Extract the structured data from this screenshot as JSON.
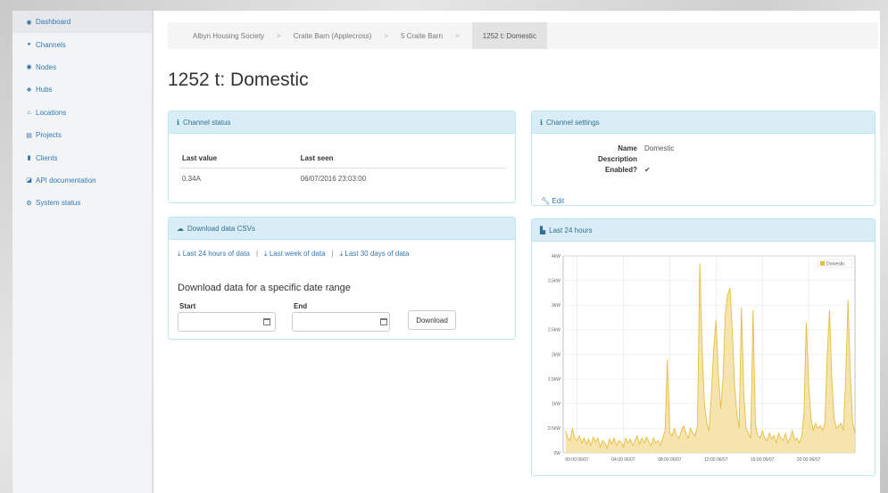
{
  "sidebar": {
    "items": [
      {
        "label": "Dashboard",
        "icon": "dashboard-icon",
        "glyph": "◉"
      },
      {
        "label": "Channels",
        "icon": "channels-icon",
        "glyph": "⚭"
      },
      {
        "label": "Nodes",
        "icon": "nodes-icon",
        "glyph": "◉"
      },
      {
        "label": "Hubs",
        "icon": "hubs-icon",
        "glyph": "❖"
      },
      {
        "label": "Locations",
        "icon": "home-icon",
        "glyph": "⌂"
      },
      {
        "label": "Projects",
        "icon": "projects-icon",
        "glyph": "▤"
      },
      {
        "label": "Clients",
        "icon": "clients-icon",
        "glyph": "▮"
      },
      {
        "label": "API documentation",
        "icon": "book-icon",
        "glyph": "◪"
      },
      {
        "label": "System status",
        "icon": "cogs-icon",
        "glyph": "⚙"
      }
    ]
  },
  "breadcrumb": {
    "items": [
      "Albyn Housing Society",
      "Craite Barn (Applecross)",
      "5 Craite Barn"
    ],
    "separator": ">",
    "active": "1252 t: Domestic"
  },
  "page": {
    "title": "1252 t: Domestic"
  },
  "channel_status": {
    "heading": "Channel status",
    "headers": [
      "Last value",
      "Last seen"
    ],
    "row": [
      "0.34A",
      "06/07/2016 23:03:00"
    ]
  },
  "channel_settings": {
    "heading": "Channel settings",
    "name_label": "Name",
    "name_value": "Domestic",
    "description_label": "Description",
    "description_value": "",
    "enabled_label": "Enabled?",
    "enabled_value": "✔",
    "edit_label": "Edit"
  },
  "download": {
    "heading": "Download data CSVs",
    "links": [
      "Last 24 hours of data",
      "Last week of data",
      "Last 30 days of data"
    ],
    "link_separator": "|",
    "range_title": "Download data for a specific date range",
    "start_label": "Start",
    "end_label": "End",
    "start_value": "",
    "end_value": "",
    "button_label": "Download"
  },
  "chart_panel": {
    "heading": "Last 24 hours"
  },
  "colors": {
    "accent": "#337ab7",
    "panel_head": "#d9edf7",
    "series_line": "#e6bd3f",
    "series_fill": "#f5dfa0"
  },
  "chart_data": {
    "type": "area",
    "title": "",
    "xlabel": "",
    "ylabel": "",
    "ylim": [
      0,
      4
    ],
    "y_ticks": [
      "0W",
      "0.5kW",
      "1kW",
      "1.5kW",
      "2kW",
      "2.5kW",
      "3kW",
      "3.5kW",
      "4kW"
    ],
    "x_ticks": [
      "00:00 06/07",
      "04:00 06/07",
      "08:00 06/07",
      "12:00 06/07",
      "16:00 06/07",
      "20:00 06/07"
    ],
    "xlim_hours": [
      -1.2,
      24.0
    ],
    "grid": true,
    "legend_position": "top-right",
    "series": [
      {
        "name": "Domestic",
        "points": [
          [
            -1.0,
            0.45
          ],
          [
            -0.8,
            0.3
          ],
          [
            -0.6,
            0.25
          ],
          [
            -0.4,
            0.5
          ],
          [
            -0.2,
            0.3
          ],
          [
            0.0,
            0.25
          ],
          [
            0.2,
            0.35
          ],
          [
            0.4,
            0.2
          ],
          [
            0.6,
            0.3
          ],
          [
            0.8,
            0.18
          ],
          [
            1.0,
            0.28
          ],
          [
            1.2,
            0.15
          ],
          [
            1.4,
            0.32
          ],
          [
            1.6,
            0.22
          ],
          [
            1.8,
            0.3
          ],
          [
            2.0,
            0.12
          ],
          [
            2.2,
            0.25
          ],
          [
            2.4,
            0.2
          ],
          [
            2.6,
            0.1
          ],
          [
            2.8,
            0.28
          ],
          [
            3.0,
            0.18
          ],
          [
            3.2,
            0.3
          ],
          [
            3.4,
            0.15
          ],
          [
            3.6,
            0.25
          ],
          [
            3.8,
            0.22
          ],
          [
            4.0,
            0.12
          ],
          [
            4.2,
            0.3
          ],
          [
            4.4,
            0.2
          ],
          [
            4.6,
            0.28
          ],
          [
            4.8,
            0.15
          ],
          [
            5.0,
            0.25
          ],
          [
            5.2,
            0.35
          ],
          [
            5.4,
            0.18
          ],
          [
            5.6,
            0.3
          ],
          [
            5.8,
            0.2
          ],
          [
            6.0,
            0.32
          ],
          [
            6.2,
            0.22
          ],
          [
            6.4,
            0.15
          ],
          [
            6.6,
            0.3
          ],
          [
            6.8,
            0.2
          ],
          [
            7.0,
            0.25
          ],
          [
            7.2,
            0.15
          ],
          [
            7.4,
            0.3
          ],
          [
            7.6,
            0.45
          ],
          [
            7.8,
            1.9
          ],
          [
            8.0,
            0.4
          ],
          [
            8.2,
            0.35
          ],
          [
            8.4,
            0.5
          ],
          [
            8.6,
            0.35
          ],
          [
            8.8,
            0.3
          ],
          [
            9.0,
            0.45
          ],
          [
            9.2,
            0.55
          ],
          [
            9.4,
            0.4
          ],
          [
            9.6,
            0.3
          ],
          [
            9.8,
            0.5
          ],
          [
            10.0,
            0.4
          ],
          [
            10.2,
            0.35
          ],
          [
            10.4,
            0.55
          ],
          [
            10.6,
            3.85
          ],
          [
            10.8,
            2.1
          ],
          [
            11.0,
            1.0
          ],
          [
            11.2,
            0.6
          ],
          [
            11.4,
            0.45
          ],
          [
            11.6,
            1.2
          ],
          [
            11.8,
            2.1
          ],
          [
            12.0,
            2.7
          ],
          [
            12.2,
            1.6
          ],
          [
            12.4,
            0.9
          ],
          [
            12.6,
            1.5
          ],
          [
            12.8,
            2.8
          ],
          [
            13.0,
            3.2
          ],
          [
            13.2,
            3.35
          ],
          [
            13.4,
            2.5
          ],
          [
            13.6,
            1.4
          ],
          [
            13.8,
            0.8
          ],
          [
            14.0,
            0.5
          ],
          [
            14.2,
            2.95
          ],
          [
            14.4,
            1.2
          ],
          [
            14.6,
            0.5
          ],
          [
            14.8,
            0.4
          ],
          [
            15.0,
            0.3
          ],
          [
            15.2,
            2.9
          ],
          [
            15.4,
            0.6
          ],
          [
            15.6,
            0.35
          ],
          [
            15.8,
            0.3
          ],
          [
            16.0,
            0.45
          ],
          [
            16.2,
            0.3
          ],
          [
            16.4,
            0.25
          ],
          [
            16.6,
            0.4
          ],
          [
            16.8,
            0.28
          ],
          [
            17.0,
            0.35
          ],
          [
            17.2,
            0.2
          ],
          [
            17.4,
            0.4
          ],
          [
            17.6,
            0.3
          ],
          [
            17.8,
            0.25
          ],
          [
            18.0,
            0.4
          ],
          [
            18.2,
            0.2
          ],
          [
            18.4,
            0.3
          ],
          [
            18.6,
            0.45
          ],
          [
            18.8,
            0.25
          ],
          [
            19.0,
            0.3
          ],
          [
            19.2,
            0.2
          ],
          [
            19.4,
            0.35
          ],
          [
            19.6,
            0.8
          ],
          [
            19.8,
            2.65
          ],
          [
            20.0,
            1.4
          ],
          [
            20.2,
            0.7
          ],
          [
            20.4,
            0.45
          ],
          [
            20.6,
            0.6
          ],
          [
            20.8,
            0.5
          ],
          [
            21.0,
            0.55
          ],
          [
            21.2,
            0.45
          ],
          [
            21.4,
            0.6
          ],
          [
            21.6,
            2.0
          ],
          [
            21.8,
            2.9
          ],
          [
            22.0,
            1.5
          ],
          [
            22.2,
            0.7
          ],
          [
            22.4,
            0.5
          ],
          [
            22.6,
            0.55
          ],
          [
            22.8,
            0.6
          ],
          [
            23.0,
            0.45
          ],
          [
            23.2,
            1.5
          ],
          [
            23.4,
            3.1
          ],
          [
            23.6,
            1.6
          ],
          [
            23.8,
            0.6
          ],
          [
            24.0,
            0.4
          ]
        ]
      }
    ]
  }
}
